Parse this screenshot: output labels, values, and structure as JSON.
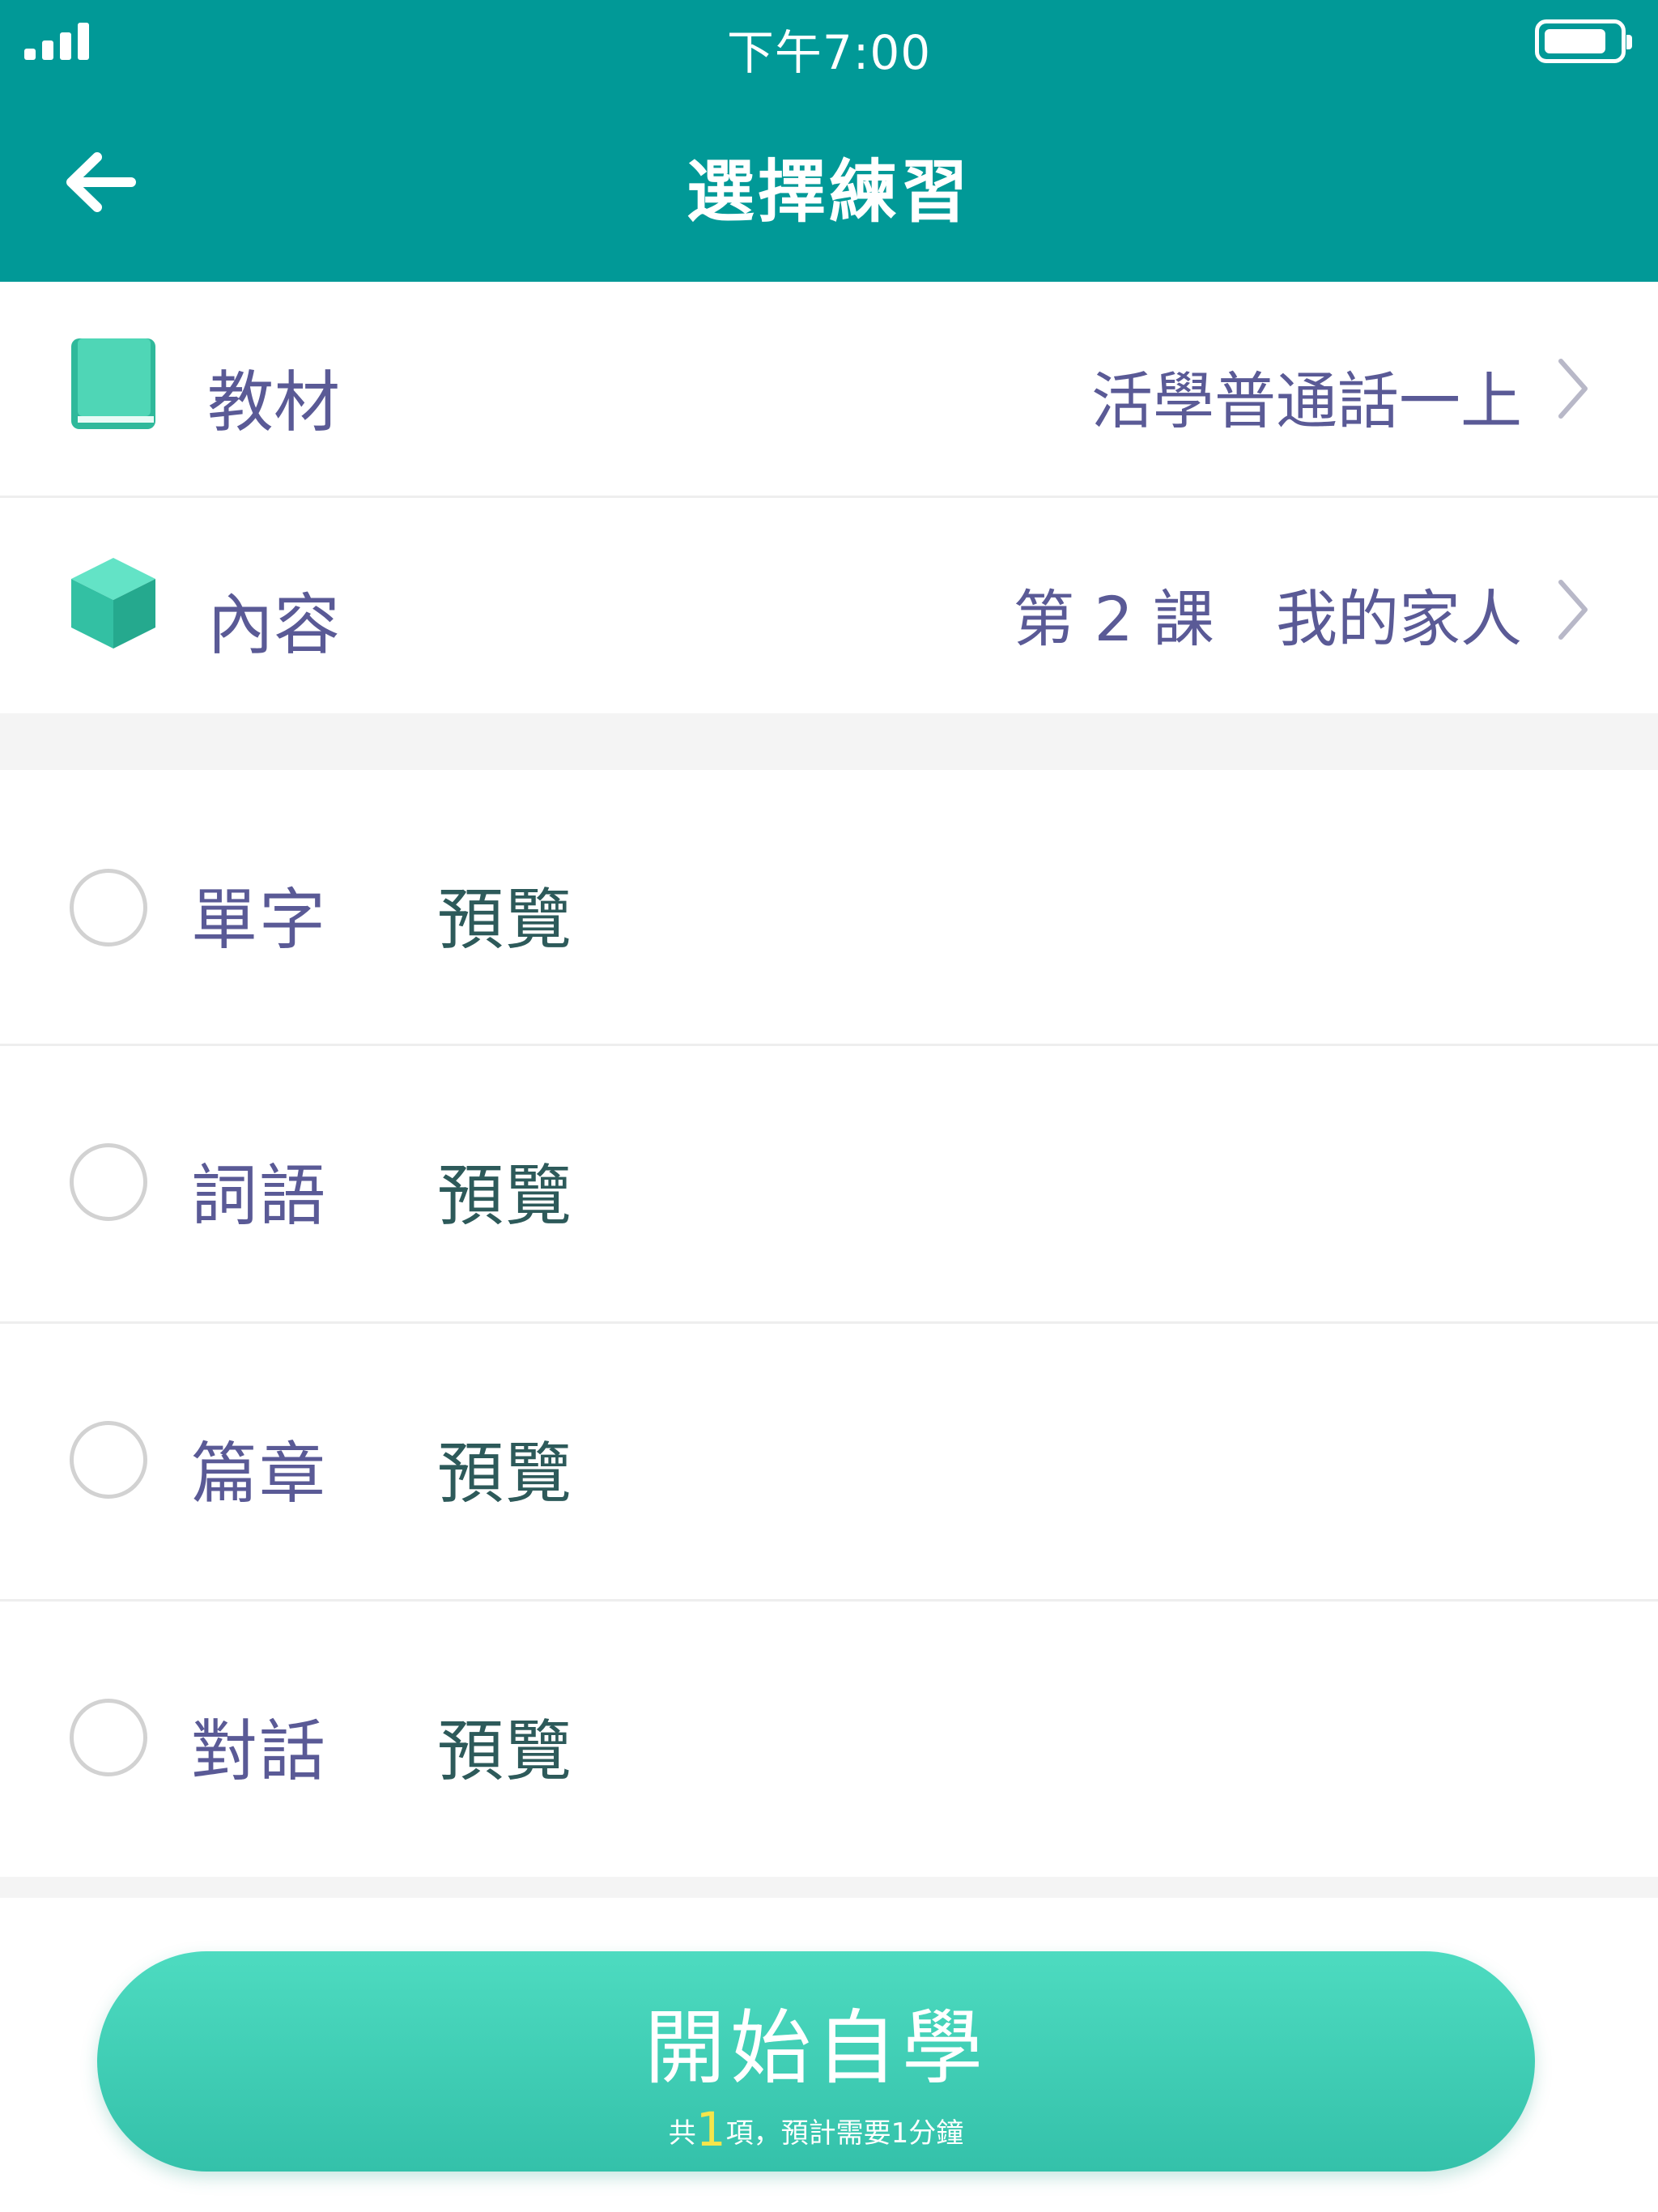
{
  "status_bar": {
    "time": "下午7:00",
    "signal_bars": 4,
    "battery_level": 0.85
  },
  "header": {
    "back_icon": "arrow-left-icon",
    "title": "選擇練習"
  },
  "settings": [
    {
      "icon": "book-icon",
      "label": "教材",
      "value": "活學普通話一上"
    },
    {
      "icon": "cube-icon",
      "label": "內容",
      "value": "第 2 課　我的家人"
    }
  ],
  "exercises": [
    {
      "label": "單字",
      "preview": "預覽",
      "selected": false
    },
    {
      "label": "詞語",
      "preview": "預覽",
      "selected": false
    },
    {
      "label": "篇章",
      "preview": "預覽",
      "selected": false
    },
    {
      "label": "對話",
      "preview": "預覽",
      "selected": false
    }
  ],
  "start_button": {
    "label": "開始自學",
    "sub_prefix": "共",
    "count": "1",
    "sub_suffix": "項，預計需要1分鐘"
  },
  "colors": {
    "header": "#019997",
    "label_text": "#5a5a96",
    "preview_text": "#2d5a5a",
    "icon_accent": "#3cc3a5",
    "button_top": "#4ddbc0",
    "button_bottom": "#34c1aa",
    "count_highlight": "#f5e54a"
  }
}
